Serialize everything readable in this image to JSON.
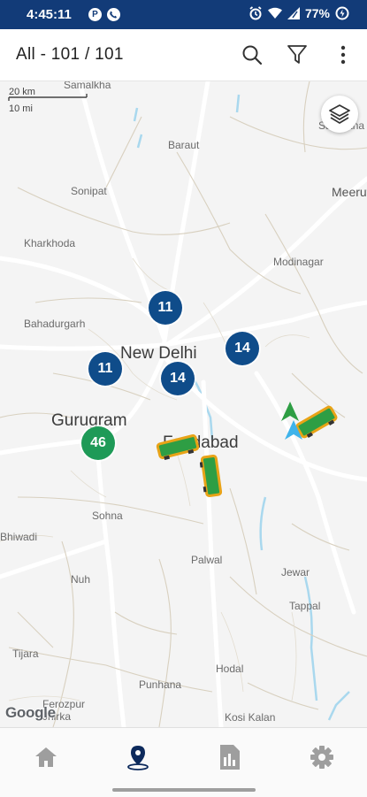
{
  "status_bar": {
    "time": "4:45:11",
    "left_icons": [
      "p-app-icon",
      "phone-icon"
    ],
    "battery_percent": "77%",
    "right_icons": [
      "alarm-icon",
      "wifi-icon",
      "signal-icon",
      "battery-icon"
    ],
    "background": "#123b78"
  },
  "app_bar": {
    "title": "All - 101 / 101",
    "actions": [
      "search-icon",
      "filter-icon",
      "more-vert-icon"
    ]
  },
  "map": {
    "scale_km": "20 km",
    "scale_mi": "10 mi",
    "attribution": "Google",
    "places": [
      {
        "name": "Samalkha",
        "big": false
      },
      {
        "name": "Baraut",
        "big": false
      },
      {
        "name": "Sardhana",
        "big": false
      },
      {
        "name": "Sonipat",
        "big": false
      },
      {
        "name": "Meerut",
        "big": false
      },
      {
        "name": "Kharkhoda",
        "big": false
      },
      {
        "name": "Modinagar",
        "big": false
      },
      {
        "name": "Bahadurgarh",
        "big": false
      },
      {
        "name": "New Delhi",
        "big": true
      },
      {
        "name": "Gurugram",
        "big": true
      },
      {
        "name": "Faridabad",
        "big": true
      },
      {
        "name": "Sohna",
        "big": false
      },
      {
        "name": "Bhiwadi",
        "big": false
      },
      {
        "name": "Palwal",
        "big": false
      },
      {
        "name": "Nuh",
        "big": false
      },
      {
        "name": "Jewar",
        "big": false
      },
      {
        "name": "Tappal",
        "big": false
      },
      {
        "name": "Tijara",
        "big": false
      },
      {
        "name": "Hodal",
        "big": false
      },
      {
        "name": "Punhana",
        "big": false
      },
      {
        "name": "Ferozpur Jhirka",
        "big": false
      },
      {
        "name": "Kosi Kalan",
        "big": false
      }
    ],
    "clusters": [
      {
        "count": "11",
        "color": "#0f4c8a"
      },
      {
        "count": "14",
        "color": "#0f4c8a"
      },
      {
        "count": "11",
        "color": "#0f4c8a"
      },
      {
        "count": "14",
        "color": "#0f4c8a"
      },
      {
        "count": "46",
        "color": "#1e9a57"
      }
    ],
    "vehicle_color": "#2e9e44",
    "vehicle_outline": "#e8a317",
    "layers_icon": "layers-icon"
  },
  "bottom_nav": {
    "items": [
      {
        "icon": "home-icon",
        "active": false
      },
      {
        "icon": "map-pin-icon",
        "active": true
      },
      {
        "icon": "reports-icon",
        "active": false
      },
      {
        "icon": "settings-icon",
        "active": false
      }
    ],
    "active_color": "#0d2a5c",
    "inactive_color": "#9e9e9e"
  }
}
